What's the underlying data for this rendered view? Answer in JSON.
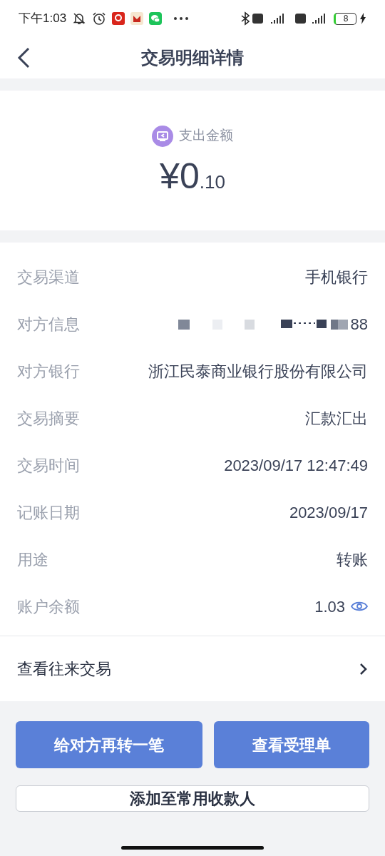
{
  "status_bar": {
    "time": "下午1:03",
    "battery": "8"
  },
  "header": {
    "title": "交易明细详情"
  },
  "amount": {
    "label": "支出金额",
    "currency": "¥",
    "integer": "0",
    "decimal": ".10"
  },
  "details": [
    {
      "label": "交易渠道",
      "value": "手机银行"
    },
    {
      "label": "对方信息",
      "value": "88",
      "masked": true
    },
    {
      "label": "对方银行",
      "value": "浙江民泰商业银行股份有限公司"
    },
    {
      "label": "交易摘要",
      "value": "汇款汇出"
    },
    {
      "label": "交易时间",
      "value": "2023/09/17 12:47:49"
    },
    {
      "label": "记账日期",
      "value": "2023/09/17"
    },
    {
      "label": "用途",
      "value": "转账"
    },
    {
      "label": "账户余额",
      "value": "1.03",
      "eye": true
    }
  ],
  "history_link": "查看往来交易",
  "buttons": [
    {
      "label": "给对方再转一笔",
      "kind": "primary"
    },
    {
      "label": "查看受理单",
      "kind": "primary"
    },
    {
      "label": "添加至常用收款人",
      "kind": "outline"
    }
  ]
}
